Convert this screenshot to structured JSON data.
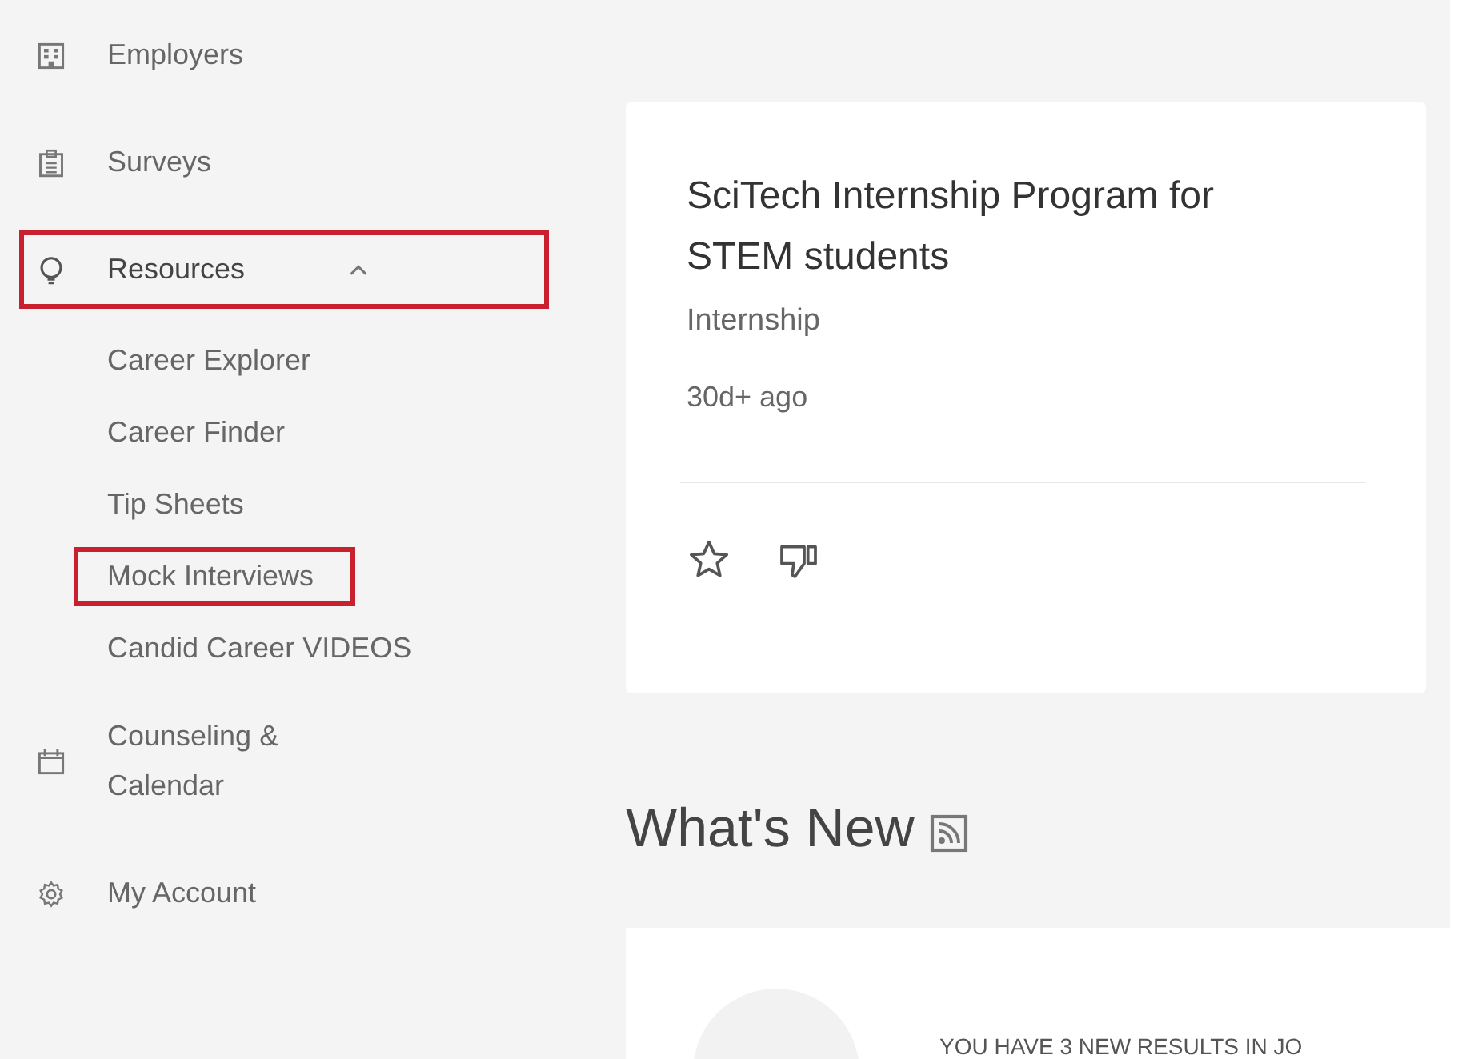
{
  "sidebar": {
    "items": [
      {
        "label": "Employers",
        "highlighted": false
      },
      {
        "label": "Surveys",
        "highlighted": false
      },
      {
        "label": "Resources",
        "highlighted": true,
        "expanded": true,
        "children": [
          {
            "label": "Career Explorer",
            "highlighted": false
          },
          {
            "label": "Career Finder",
            "highlighted": false
          },
          {
            "label": "Tip Sheets",
            "highlighted": false
          },
          {
            "label": "Mock Interviews",
            "highlighted": true
          },
          {
            "label": "Candid Career VIDEOS",
            "highlighted": false
          }
        ]
      },
      {
        "label": "Counseling & Calendar",
        "highlighted": false
      },
      {
        "label": "My Account",
        "highlighted": false
      }
    ]
  },
  "job_card": {
    "title": "SciTech Internship Program for STEM students",
    "type": "Internship",
    "posted": "30d+ ago"
  },
  "whats_new": {
    "heading": "What's New",
    "notice": "YOU HAVE 3 NEW RESULTS IN JO"
  }
}
